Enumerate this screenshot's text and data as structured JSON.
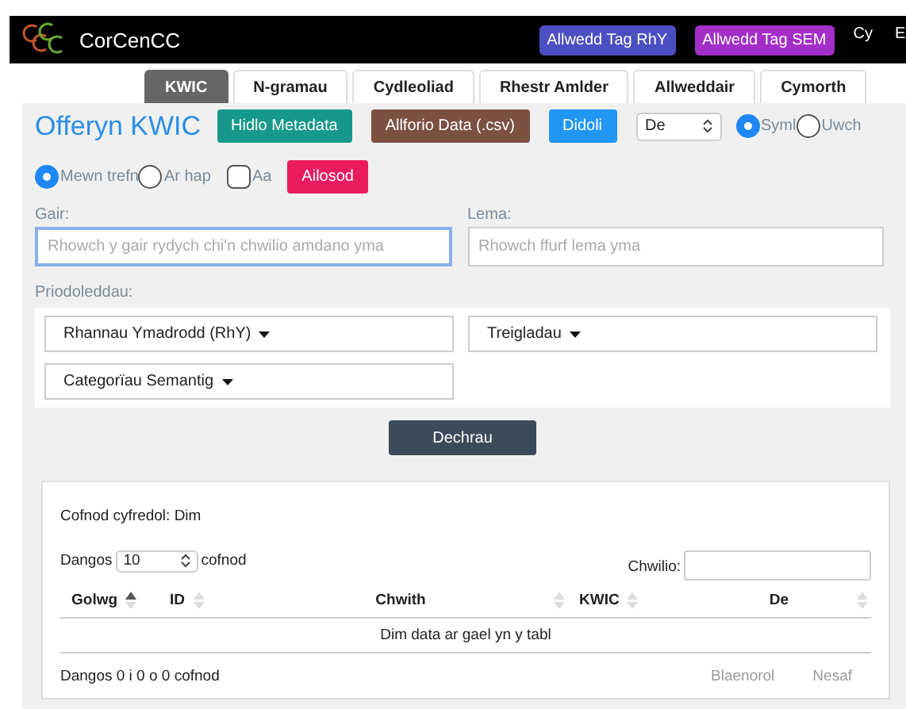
{
  "header": {
    "brand": "CorCenCC",
    "buttons": [
      {
        "label": "Allwedd Tag RhY",
        "color": "#4a4fc2"
      },
      {
        "label": "Allwedd Tag SEM",
        "color": "#a42ec8"
      }
    ],
    "languages": [
      "Cy",
      "E"
    ]
  },
  "tabs": [
    {
      "label": "KWIC",
      "selected": true
    },
    {
      "label": "N-gramau",
      "selected": false
    },
    {
      "label": "Cydleoliad",
      "selected": false
    },
    {
      "label": "Rhestr Amlder",
      "selected": false
    },
    {
      "label": "Allweddair",
      "selected": false
    },
    {
      "label": "Cymorth",
      "selected": false
    }
  ],
  "toolbar": {
    "title": "Offeryn KWIC",
    "buttons": [
      {
        "label": "Hidlo Metadata",
        "color": "#16998a"
      },
      {
        "label": "Allforio Data (.csv)",
        "color": "#7b5142"
      },
      {
        "label": "Didoli",
        "color": "#2196f3"
      }
    ],
    "sort_select": "De",
    "modes": [
      {
        "label": "Syml",
        "selected": true
      },
      {
        "label": "Uwch",
        "selected": false
      }
    ]
  },
  "order": [
    {
      "label": "Mewn trefn",
      "selected": true
    },
    {
      "label": "Ar hap",
      "selected": false
    }
  ],
  "case_option": {
    "label": "Aa",
    "checked": false
  },
  "reset_button": "Ailosod",
  "fields": [
    {
      "label": "Gair:",
      "placeholder": "Rhowch y gair rydych chi'n chwilio amdano yma",
      "focused": true
    },
    {
      "label": "Lema:",
      "placeholder": "Rhowch ffurf lema yma",
      "focused": false
    }
  ],
  "attributes": {
    "label": "Priodoleddau:",
    "dropdowns": [
      "Rhannau Ymadrodd (RhY)",
      "Treigladau",
      "Categorïau Semantig"
    ]
  },
  "start_button": "Dechrau",
  "results": {
    "current_record": "Cofnod cyfredol: Dim",
    "show_prefix": "Dangos",
    "page_size": "10",
    "show_suffix": "cofnod",
    "search_label": "Chwilio:",
    "columns": [
      {
        "label": "Golwg",
        "sorted": true
      },
      {
        "label": "ID",
        "sorted": false
      },
      {
        "label": "Chwith",
        "sorted": false
      },
      {
        "label": "KWIC",
        "sorted": false
      },
      {
        "label": "De",
        "sorted": false
      }
    ],
    "empty_message": "Dim data ar gael yn y tabl",
    "info": "Dangos 0 i 0 o 0 cofnod",
    "pager": [
      "Blaenorol",
      "Nesaf"
    ]
  }
}
